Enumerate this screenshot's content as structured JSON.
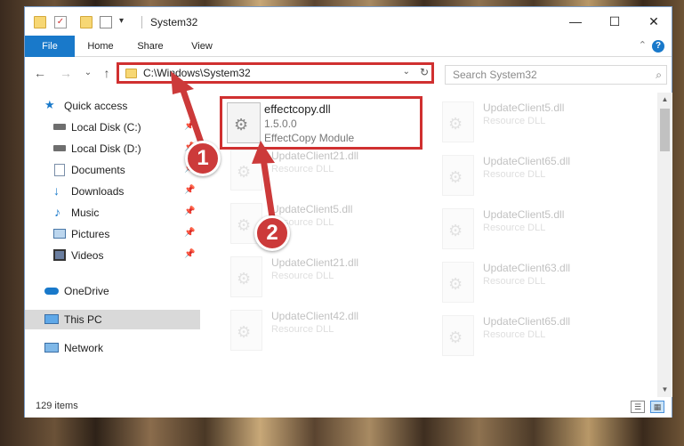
{
  "window": {
    "title": "System32",
    "controls": {
      "minimize": "—",
      "maximize": "☐",
      "close": "✕"
    }
  },
  "ribbon": {
    "tabs": [
      {
        "label": "File"
      },
      {
        "label": "Home"
      },
      {
        "label": "Share"
      },
      {
        "label": "View"
      }
    ],
    "help": "?"
  },
  "nav": {
    "back": "←",
    "forward": "→",
    "recent": "⌄",
    "up": "↑",
    "address": "C:\\Windows\\System32",
    "refresh": "↻",
    "search_placeholder": "Search System32"
  },
  "sidebar": {
    "items": [
      {
        "label": "Quick access"
      },
      {
        "label": "Local Disk (C:)"
      },
      {
        "label": "Local Disk (D:)"
      },
      {
        "label": "Documents"
      },
      {
        "label": "Downloads"
      },
      {
        "label": "Music"
      },
      {
        "label": "Pictures"
      },
      {
        "label": "Videos"
      },
      {
        "label": "OneDrive"
      },
      {
        "label": "This PC"
      },
      {
        "label": "Network"
      }
    ]
  },
  "highlighted_file": {
    "name": "effectcopy.dll",
    "version": "1.5.0.0",
    "description": "EffectCopy Module"
  },
  "files": [
    {
      "name": "UpdateClient5.dll",
      "description": "Resource DLL"
    },
    {
      "name": "UpdateClient21.dll",
      "description": "Resource DLL"
    },
    {
      "name": "UpdateClient65.dll",
      "description": "Resource DLL"
    },
    {
      "name": "UpdateClient5.dll",
      "description": "Resource DLL"
    },
    {
      "name": "UpdateClient5.dll",
      "description": "Resource DLL"
    },
    {
      "name": "UpdateClient21.dll",
      "description": "Resource DLL"
    },
    {
      "name": "UpdateClient63.dll",
      "description": "Resource DLL"
    },
    {
      "name": "UpdateClient42.dll",
      "description": "Resource DLL"
    },
    {
      "name": "UpdateClient65.dll",
      "description": "Resource DLL"
    }
  ],
  "status": {
    "item_count": "129 items"
  },
  "annotations": {
    "badge1": "1",
    "badge2": "2",
    "color": "#cc3a3a"
  }
}
